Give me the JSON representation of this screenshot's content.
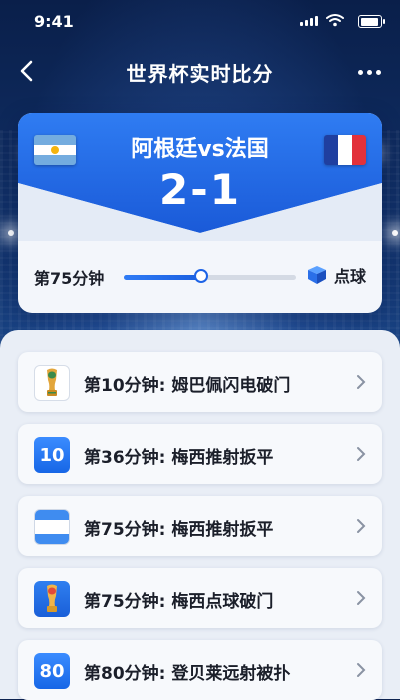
{
  "status_bar": {
    "time": "9:41"
  },
  "nav": {
    "title": "世界杯实时比分"
  },
  "match": {
    "teams": "阿根廷vs法国",
    "score": "2-1",
    "current_minute_label": "第75分钟",
    "progress": 0.45,
    "current_event_label": "点球",
    "colors": {
      "accent": "#1d63e6",
      "header_blue": "#2a76f0"
    }
  },
  "events": [
    {
      "badge_type": "trophy-icon",
      "text": "第10分钟: 姆巴佩闪电破门"
    },
    {
      "badge_type": "number",
      "badge_text": "10",
      "text": "第36分钟: 梅西推射扳平"
    },
    {
      "badge_type": "flag-icon",
      "text": "第75分钟: 梅西推射扳平"
    },
    {
      "badge_type": "trophy-icon",
      "text": "第75分钟: 梅西点球破门"
    },
    {
      "badge_type": "number",
      "badge_text": "80",
      "text": "第80分钟: 登贝莱远射被扑"
    }
  ]
}
